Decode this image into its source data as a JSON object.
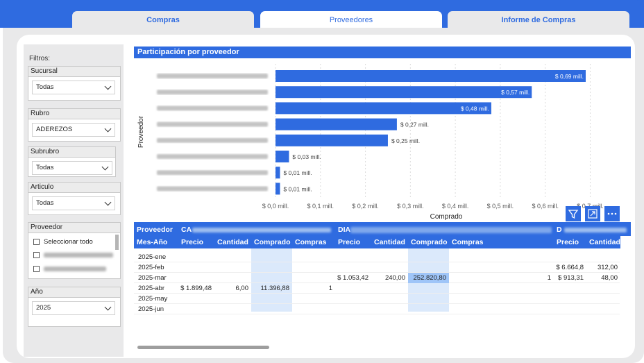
{
  "tabs": [
    {
      "label": "Compras",
      "active": false
    },
    {
      "label": "Proveedores",
      "active": true
    },
    {
      "label": "Informe de Compras",
      "active": false
    }
  ],
  "filters": {
    "title": "Filtros:",
    "sucursal": {
      "label": "Sucursal",
      "value": "Todas"
    },
    "rubro": {
      "label": "Rubro",
      "value": "ADEREZOS"
    },
    "subrubro": {
      "label": "Subrubro",
      "value": "Todas"
    },
    "articulo": {
      "label": "Articulo",
      "value": "Todas"
    },
    "proveedor": {
      "label": "Proveedor",
      "select_all": "Seleccionar todo"
    },
    "anio": {
      "label": "Año",
      "value": "2025"
    }
  },
  "chart_data": {
    "type": "bar",
    "orientation": "horizontal",
    "title": "Participación por proveedor",
    "xlabel": "Comprado",
    "ylabel": "Proveedor",
    "xlim": [
      0,
      0.7
    ],
    "x_ticks": [
      "$ 0,0 mill.",
      "$ 0,1 mill.",
      "$ 0,2 mill.",
      "$ 0,3 mill.",
      "$ 0,4 mill.",
      "$ 0,5 mill.",
      "$ 0,6 mill.",
      "$ 0,7 mill."
    ],
    "values": [
      0.69,
      0.57,
      0.48,
      0.27,
      0.25,
      0.03,
      0.01,
      0.01
    ],
    "data_labels": [
      "$ 0,69 mill.",
      "$ 0,57 mill.",
      "$ 0,48 mill.",
      "$ 0,27 mill.",
      "$ 0,25 mill.",
      "$ 0,03 mill.",
      "$ 0,01 mill.",
      "$ 0,01 mill."
    ],
    "bar_color": "#2f6be0",
    "grid": "vertical dashed"
  },
  "visual_actions": {
    "filter_icon": "filter-icon",
    "focus_icon": "focus-mode-icon",
    "more_icon": "more-options-icon"
  },
  "matrix": {
    "row_header": "Proveedor",
    "row_sub_header": "Mes-Año",
    "groups": [
      "CA",
      "DIA",
      "D"
    ],
    "columns": [
      "Precio",
      "Cantidad",
      "Comprado",
      "Compras",
      "Precio",
      "Cantidad",
      "Comprado",
      "Compras",
      "Precio",
      "Cantidad"
    ],
    "rows": [
      {
        "label": "2025-ene",
        "cells": [
          "",
          "",
          "",
          "",
          "",
          "",
          "",
          "",
          "",
          ""
        ]
      },
      {
        "label": "2025-feb",
        "cells": [
          "",
          "",
          "",
          "",
          "",
          "",
          "",
          "",
          "$ 6.664,8",
          "312,00"
        ]
      },
      {
        "label": "2025-mar",
        "cells": [
          "",
          "",
          "",
          "",
          "$ 1.053,42",
          "240,00",
          "252.820,80",
          "1",
          "$ 913,31",
          "48,00"
        ]
      },
      {
        "label": "2025-abr",
        "cells": [
          "$ 1.899,48",
          "6,00",
          "11.396,88",
          "1",
          "",
          "",
          "",
          "",
          "",
          ""
        ]
      },
      {
        "label": "2025-may",
        "cells": [
          "",
          "",
          "",
          "",
          "",
          "",
          "",
          "",
          "",
          ""
        ]
      },
      {
        "label": "2025-jun",
        "cells": [
          "",
          "",
          "",
          "",
          "",
          "",
          "",
          "",
          "",
          ""
        ]
      }
    ]
  }
}
